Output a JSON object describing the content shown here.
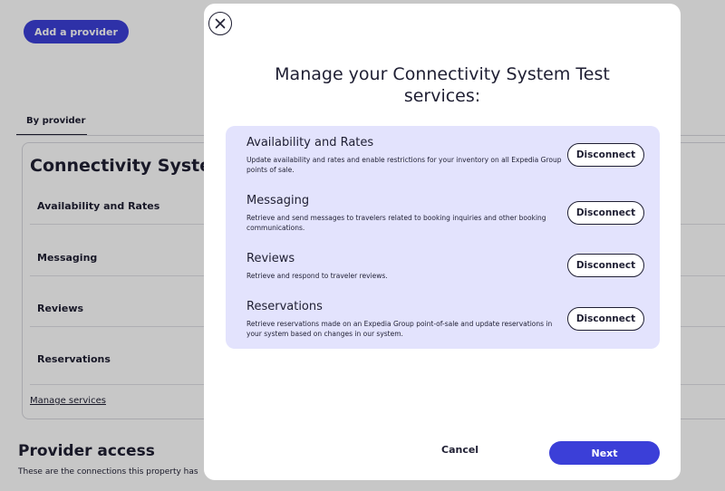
{
  "background": {
    "add_provider_label": "Add a provider",
    "tab_by_provider": "By provider",
    "provider_name": "Connectivity System",
    "services": [
      "Availability and Rates",
      "Messaging",
      "Reviews",
      "Reservations"
    ],
    "manage_services_link": "Manage services",
    "provider_access_title": "Provider access",
    "provider_access_desc": "These are the connections this property has"
  },
  "modal": {
    "close_icon": "close-icon",
    "title": "Manage your Connectivity System Test services:",
    "services": [
      {
        "name": "Availability and Rates",
        "description": "Update availability and rates and enable restrictions for your inventory on all Expedia Group points of sale.",
        "action": "Disconnect"
      },
      {
        "name": "Messaging",
        "description": "Retrieve and send messages to travelers related to booking inquiries and other booking communications.",
        "action": "Disconnect"
      },
      {
        "name": "Reviews",
        "description": "Retrieve and respond to traveler reviews.",
        "action": "Disconnect"
      },
      {
        "name": "Reservations",
        "description": "Retrieve reservations made on an Expedia Group point-of-sale and update reservations in your system based on changes in our system.",
        "action": "Disconnect"
      }
    ],
    "cancel_label": "Cancel",
    "next_label": "Next"
  },
  "colors": {
    "primary": "#3b3fd8",
    "panel": "#e3e3fd",
    "text": "#1f1f33"
  }
}
